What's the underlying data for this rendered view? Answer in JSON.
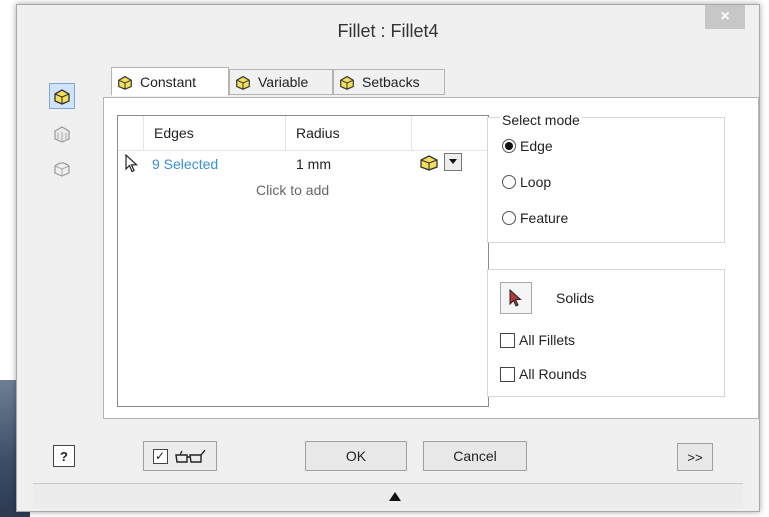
{
  "window": {
    "title": "Fillet : Fillet4",
    "close_glyph": "×"
  },
  "tabs": [
    {
      "label": "Constant",
      "icon": "fillet-constant-icon"
    },
    {
      "label": "Variable",
      "icon": "fillet-variable-icon"
    },
    {
      "label": "Setbacks",
      "icon": "fillet-setbacks-icon"
    }
  ],
  "grid": {
    "headers": {
      "edges": "Edges",
      "radius": "Radius"
    },
    "row": {
      "edges": "9 Selected",
      "radius": "1 mm"
    },
    "add_text": "Click to add"
  },
  "select_mode": {
    "label": "Select mode",
    "options": [
      {
        "label": "Edge",
        "selected": true
      },
      {
        "label": "Loop",
        "selected": false
      },
      {
        "label": "Feature",
        "selected": false
      }
    ]
  },
  "solids": {
    "label": "Solids",
    "all_fillets": "All Fillets",
    "all_rounds": "All Rounds"
  },
  "footer": {
    "ok": "OK",
    "cancel": "Cancel",
    "expand": ">>",
    "help": "?",
    "preview_check": "✓"
  },
  "colors": {
    "accent_blue": "#3b8ed8",
    "tab_icon_yellow": "#f3df5a"
  }
}
